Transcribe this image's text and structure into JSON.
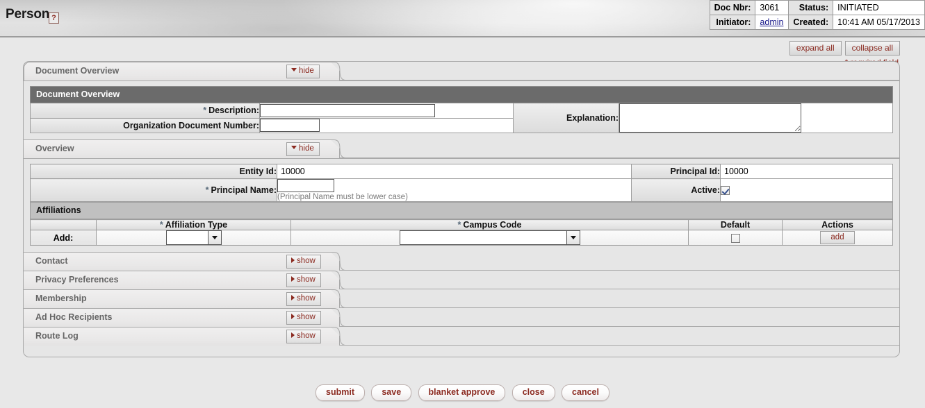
{
  "header": {
    "title": "Person",
    "help_icon": "question-mark-icon",
    "doc_info": [
      {
        "label": "Doc Nbr:",
        "value": "3061",
        "label2": "Status:",
        "value2": "INITIATED"
      },
      {
        "label": "Initiator:",
        "value": "admin",
        "label2": "Created:",
        "value2": "10:41 AM 05/17/2013"
      }
    ]
  },
  "toolbar": {
    "expand_all": "expand all",
    "collapse_all": "collapse all",
    "required_note": "* required field"
  },
  "sections": {
    "document_overview": {
      "tab_title": "Document Overview",
      "toggle_label": "hide",
      "sub_header": "Document Overview",
      "description_label": "Description:",
      "description_value": "",
      "org_doc_nbr_label": "Organization Document Number:",
      "org_doc_nbr_value": "",
      "explanation_label": "Explanation:",
      "explanation_value": ""
    },
    "overview": {
      "tab_title": "Overview",
      "toggle_label": "hide",
      "entity_id_label": "Entity Id:",
      "entity_id_value": "10000",
      "principal_id_label": "Principal Id:",
      "principal_id_value": "10000",
      "principal_name_label": "Principal Name:",
      "principal_name_value": "",
      "principal_name_hint": "(Principal Name must be lower case)",
      "active_label": "Active:",
      "active_checked": true,
      "affiliations": {
        "header": "Affiliations",
        "columns": [
          "",
          "Affiliation Type",
          "Campus Code",
          "Default",
          "Actions"
        ],
        "add_row_label": "Add:",
        "affiliation_type_value": "",
        "campus_code_value": "",
        "default_checked": false,
        "add_button": "add"
      }
    },
    "collapsed": [
      {
        "tab_title": "Contact",
        "toggle_label": "show"
      },
      {
        "tab_title": "Privacy Preferences",
        "toggle_label": "show"
      },
      {
        "tab_title": "Membership",
        "toggle_label": "show"
      },
      {
        "tab_title": "Ad Hoc Recipients",
        "toggle_label": "show"
      },
      {
        "tab_title": "Route Log",
        "toggle_label": "show"
      }
    ]
  },
  "footer": {
    "buttons": [
      "submit",
      "save",
      "blanket approve",
      "close",
      "cancel"
    ]
  },
  "colors": {
    "accent_red": "#8b2a20",
    "sub_header_bg": "#6b6b6b",
    "page_bg": "#e8e8e8",
    "link_blue": "#1a1a8c"
  }
}
